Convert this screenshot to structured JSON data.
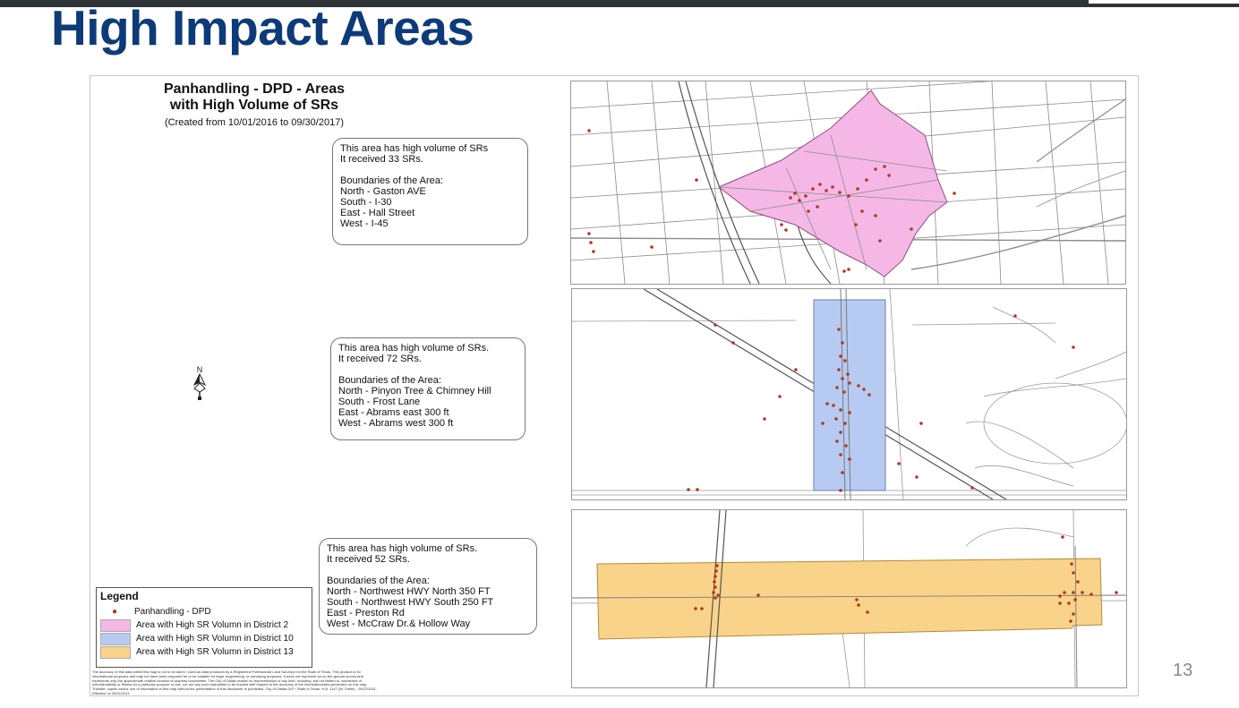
{
  "slide": {
    "title": "High Impact Areas",
    "page_number": "13"
  },
  "sheet": {
    "title_line1": "Panhandling - DPD - Areas",
    "title_line2": "with High Volume of SRs",
    "subtitle": "(Created from 10/01/2016 to 09/30/2017)",
    "north_arrow_letter": "N"
  },
  "callouts": [
    {
      "line1": "This area has high volume of SRs",
      "line2": " It received 33 SRs.",
      "heading": "Boundaries of the Area:",
      "north": "North - Gaston AVE",
      "south": "South - I-30",
      "east": "East - Hall Street",
      "west": "West - I-45"
    },
    {
      "line1": "This area has high volume of SRs.",
      "line2": "It received 72 SRs.",
      "heading": "Boundaries of the Area:",
      "north": "North - Pinyon Tree & Chimney Hill",
      "south": "South - Frost Lane",
      "east": "East - Abrams east 300 ft",
      "west": "West - Abrams west 300 ft"
    },
    {
      "line1": "This area has high volume of SRs.",
      "line2": " It received 52 SRs.",
      "heading": "Boundaries of the Area:",
      "north": "North - Northwest HWY North 350 FT",
      "south": "South - Northwest HWY South 250 FT",
      "east": "East - Preston Rd",
      "west": "West - McCraw Dr.& Hollow Way"
    }
  ],
  "legend": {
    "title": "Legend",
    "items": [
      {
        "label": "Panhandling - DPD",
        "color": "#b0381e"
      },
      {
        "label": "Area with High SR Volumn in District 2",
        "color": "#f5b8e6"
      },
      {
        "label": "Area with High SR Volumn in District 10",
        "color": "#b7cbf2"
      },
      {
        "label": "Area with High SR Volumn in District 13",
        "color": "#f9d38a"
      }
    ]
  },
  "disclaimer": "The accuracy of this data within this map is not to be taken / used as data produced by a Registered Professional Land Surveyor for the State of Texas. This product is for informational purposes and may not have been prepared for or be suitable for legal, engineering, or surveying purposes. It does not represent an on-the-ground survey and represents only the approximate relative location of property boundaries. The City of Dallas makes no representation of any kind, including, but not limited to, warranties of merchantability or fitness for a particular purpose or use, nor are any such warranties to be implied with respect to the accuracy of the information/data presented on this map. Transfer, copies and/or use of information in this map without the presentation of this disclaimer is prohibited. City of Dallas GIS * State of Texas, H.B. 1147 (W. Smith) - 05/27/2011, Effective on 09/01/2011",
  "colors": {
    "title_blue": "#0d3b79",
    "sr_dot": "#b0381e",
    "district2": "#f5b8e6",
    "district10": "#b7cbf2",
    "district13": "#f9d38a"
  }
}
